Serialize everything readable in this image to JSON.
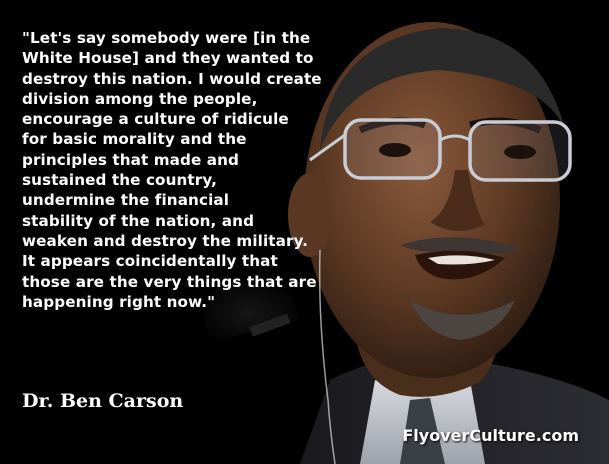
{
  "quote": {
    "lines": [
      "\"Let's say somebody were [in the",
      "White House] and they wanted to",
      "destroy this nation. I would create",
      "division among the people,",
      "encourage a culture of ridicule",
      "for basic morality and the",
      "principles that made and",
      "sustained the country,",
      "undermine the financial",
      "stability of the nation, and",
      "weaken and destroy the military.",
      "It appears coincidentally that",
      "those are the very things that are",
      "happening right now.\""
    ]
  },
  "attribution": "Dr. Ben Carson",
  "watermark": "FlyoverCulture.com",
  "colors": {
    "background": "#000000",
    "text": "#ffffff"
  }
}
